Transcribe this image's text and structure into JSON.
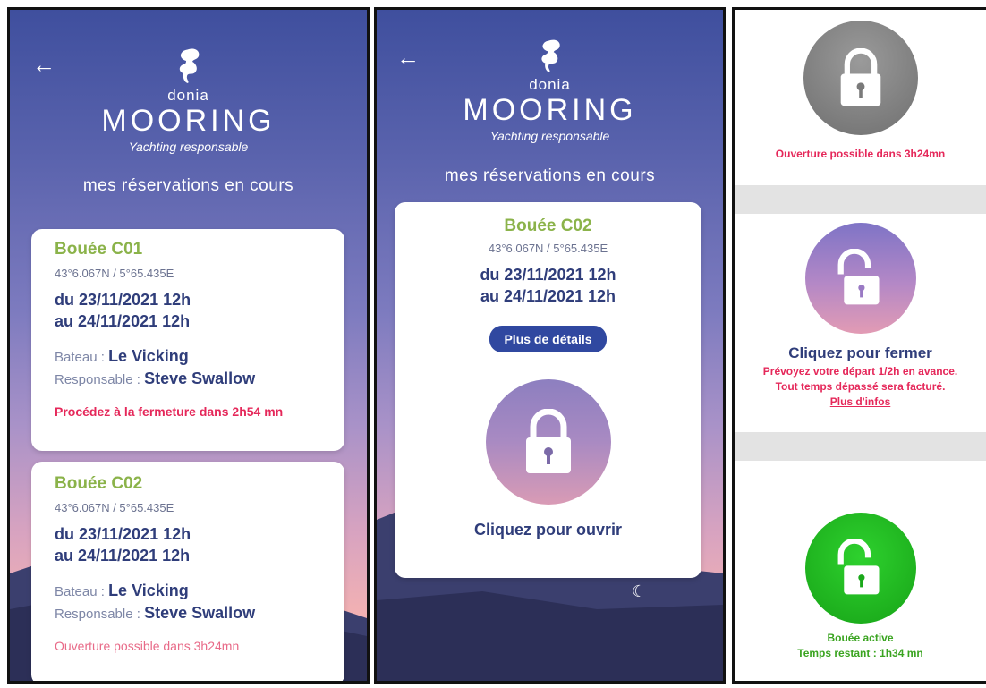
{
  "logo": {
    "brand_small": "donia",
    "brand_big": "MOORING",
    "tagline": "Yachting responsable"
  },
  "section_title": "mes réservations en cours",
  "panel1": {
    "cards": [
      {
        "buoy": "Bouée C01",
        "coords": "43°6.067N / 5°65.435E",
        "date_from": "du 23/11/2021 12h",
        "date_to": "au 24/11/2021 12h",
        "boat_label": "Bateau :",
        "boat_name": "Le Vicking",
        "owner_label": "Responsable :",
        "owner_name": "Steve Swallow",
        "status": "Procédez à la fermeture dans 2h54 mn"
      },
      {
        "buoy": "Bouée C02",
        "coords": "43°6.067N / 5°65.435E",
        "date_from": "du 23/11/2021 12h",
        "date_to": "au 24/11/2021 12h",
        "boat_label": "Bateau :",
        "boat_name": "Le Vicking",
        "owner_label": "Responsable :",
        "owner_name": "Steve Swallow",
        "status": "Ouverture possible dans 3h24mn"
      }
    ]
  },
  "panel2": {
    "buoy": "Bouée C02",
    "coords": "43°6.067N / 5°65.435E",
    "date_from": "du 23/11/2021 12h",
    "date_to": "au 24/11/2021 12h",
    "details_button": "Plus de détails",
    "lock_icon": "locked-padlock-icon",
    "action_label": "Cliquez pour ouvrir"
  },
  "panel3": {
    "states": [
      {
        "icon": "locked-padlock-icon",
        "color": "#8a8a8a",
        "text": "Ouverture possible dans 3h24mn"
      },
      {
        "icon": "unlocked-padlock-icon",
        "color": "#9a6fc4",
        "title": "Cliquez pour fermer",
        "warn_line1": "Prévoyez votre départ 1/2h en avance.",
        "warn_line2": "Tout temps dépassé sera facturé.",
        "link": "Plus d'infos"
      },
      {
        "icon": "unlocked-padlock-icon",
        "color": "#1aa81a",
        "line1": "Bouée active",
        "line2": "Temps restant : 1h34 mn"
      }
    ]
  },
  "colors": {
    "accent_green": "#8bb34a",
    "navy": "#2f3d7a",
    "alert_red": "#e5285a"
  }
}
